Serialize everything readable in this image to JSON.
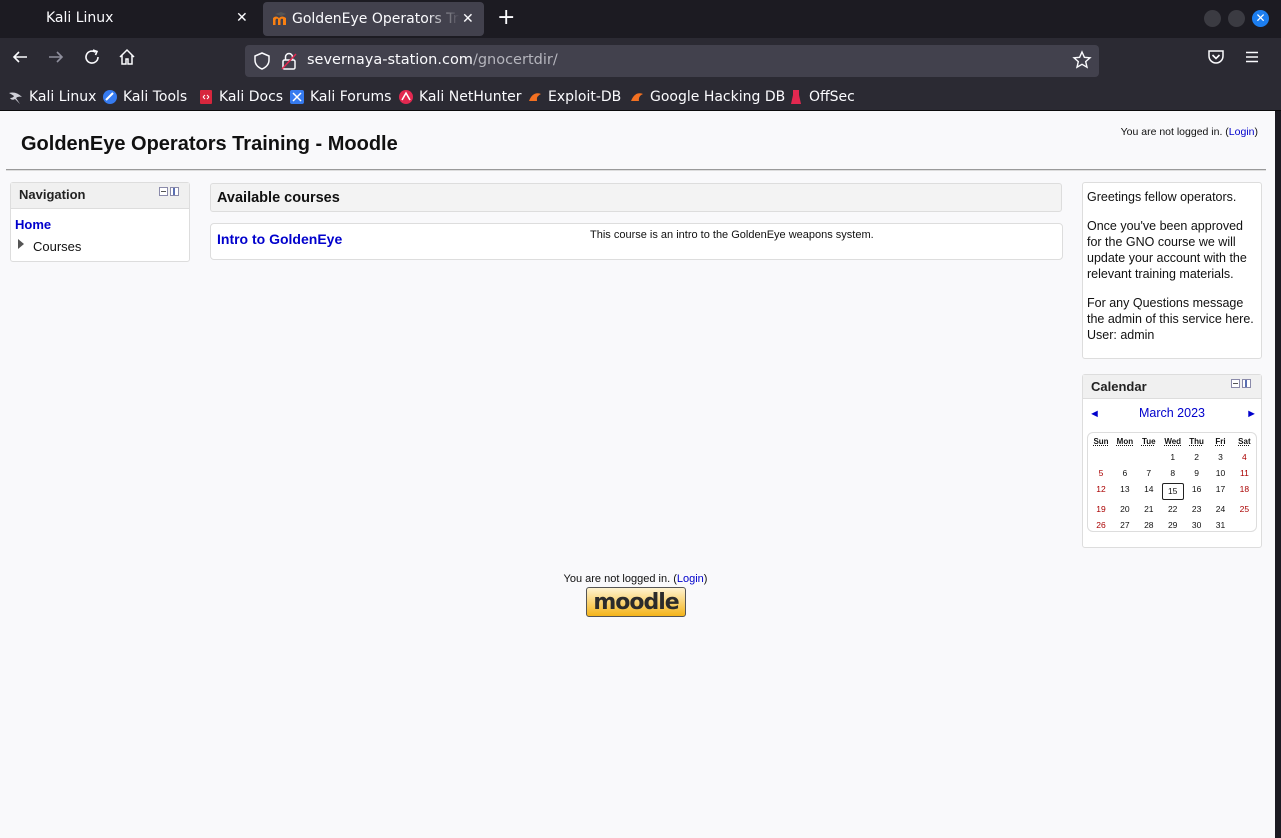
{
  "browser": {
    "tabs": [
      {
        "title": "Kali Linux"
      },
      {
        "title": "GoldenEye Operators Training - Moodle"
      }
    ],
    "url_domain": "severnaya-station.com",
    "url_path": "/gnocertdir/",
    "bookmarks": [
      "Kali Linux",
      "Kali Tools",
      "Kali Docs",
      "Kali Forums",
      "Kali NetHunter",
      "Exploit-DB",
      "Google Hacking DB",
      "OffSec"
    ],
    "colors": {
      "chrome_dark": "#1c1b22",
      "toolbar": "#2b2a33",
      "urlbar": "#42414d",
      "accent": "#1c7ef0"
    }
  },
  "page": {
    "title": "GoldenEye Operators Training - Moodle",
    "login_prefix": "You are not logged in. (",
    "login_link": "Login",
    "login_suffix": ")",
    "navigation": {
      "header": "Navigation",
      "home": "Home",
      "courses": "Courses"
    },
    "available_courses": {
      "header": "Available courses",
      "course_name": "Intro to GoldenEye",
      "course_summary": "This course is an intro to the GoldenEye weapons system."
    },
    "greeting": {
      "p1": "Greetings fellow operators.",
      "p2": "Once you've been approved for the GNO course we will update your account with the relevant training materials.",
      "p3": "For any Questions message the admin of this service here. User: admin"
    },
    "calendar": {
      "header": "Calendar",
      "prev": "◄",
      "month": "March 2023",
      "next": "►",
      "weekdays": [
        "Sun",
        "Mon",
        "Tue",
        "Wed",
        "Thu",
        "Fri",
        "Sat"
      ],
      "first_weekday_index": 3,
      "days_in_month": 31,
      "today": 15
    },
    "footer": {
      "login_prefix": "You are not logged in. (",
      "login_link": "Login",
      "login_suffix": ")",
      "logo_text": "moodle"
    }
  }
}
